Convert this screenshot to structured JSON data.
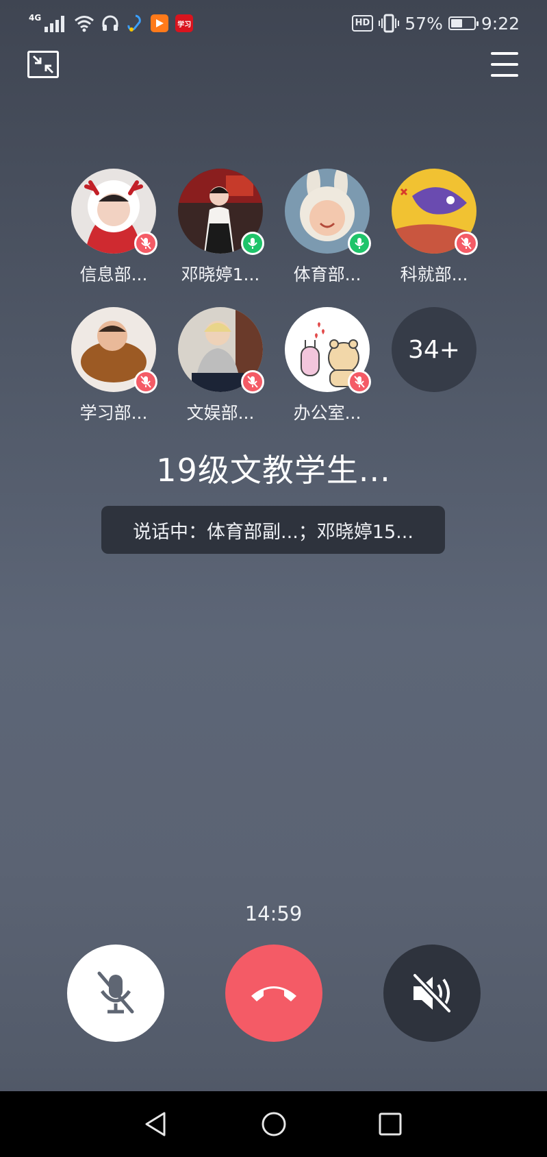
{
  "status_bar": {
    "network": "4G",
    "icons": [
      "signal-icon",
      "wifi-icon",
      "headphones-icon",
      "app-hook-icon",
      "app-play-icon",
      "app-study-icon"
    ],
    "study_badge_text": "学习",
    "hd_label": "HD",
    "battery_percent": "57%",
    "battery_level": 0.57,
    "time": "9:22"
  },
  "participants": [
    {
      "name": "信息部...",
      "muted": true
    },
    {
      "name": "邓晓婷1...",
      "muted": false
    },
    {
      "name": "体育部...",
      "muted": false
    },
    {
      "name": "科就部...",
      "muted": true
    },
    {
      "name": "学习部...",
      "muted": true
    },
    {
      "name": "文娱部...",
      "muted": true
    },
    {
      "name": "办公室...",
      "muted": true
    }
  ],
  "more_count": "34+",
  "group_title": "19级文教学生...",
  "speaking_text": "说话中：体育部副...；邓晓婷15...",
  "call_timer": "14:59",
  "colors": {
    "muted_badge": "#f45b66",
    "active_badge": "#1fc46a",
    "hangup": "#f45b66",
    "dark_button": "#2e333d"
  }
}
